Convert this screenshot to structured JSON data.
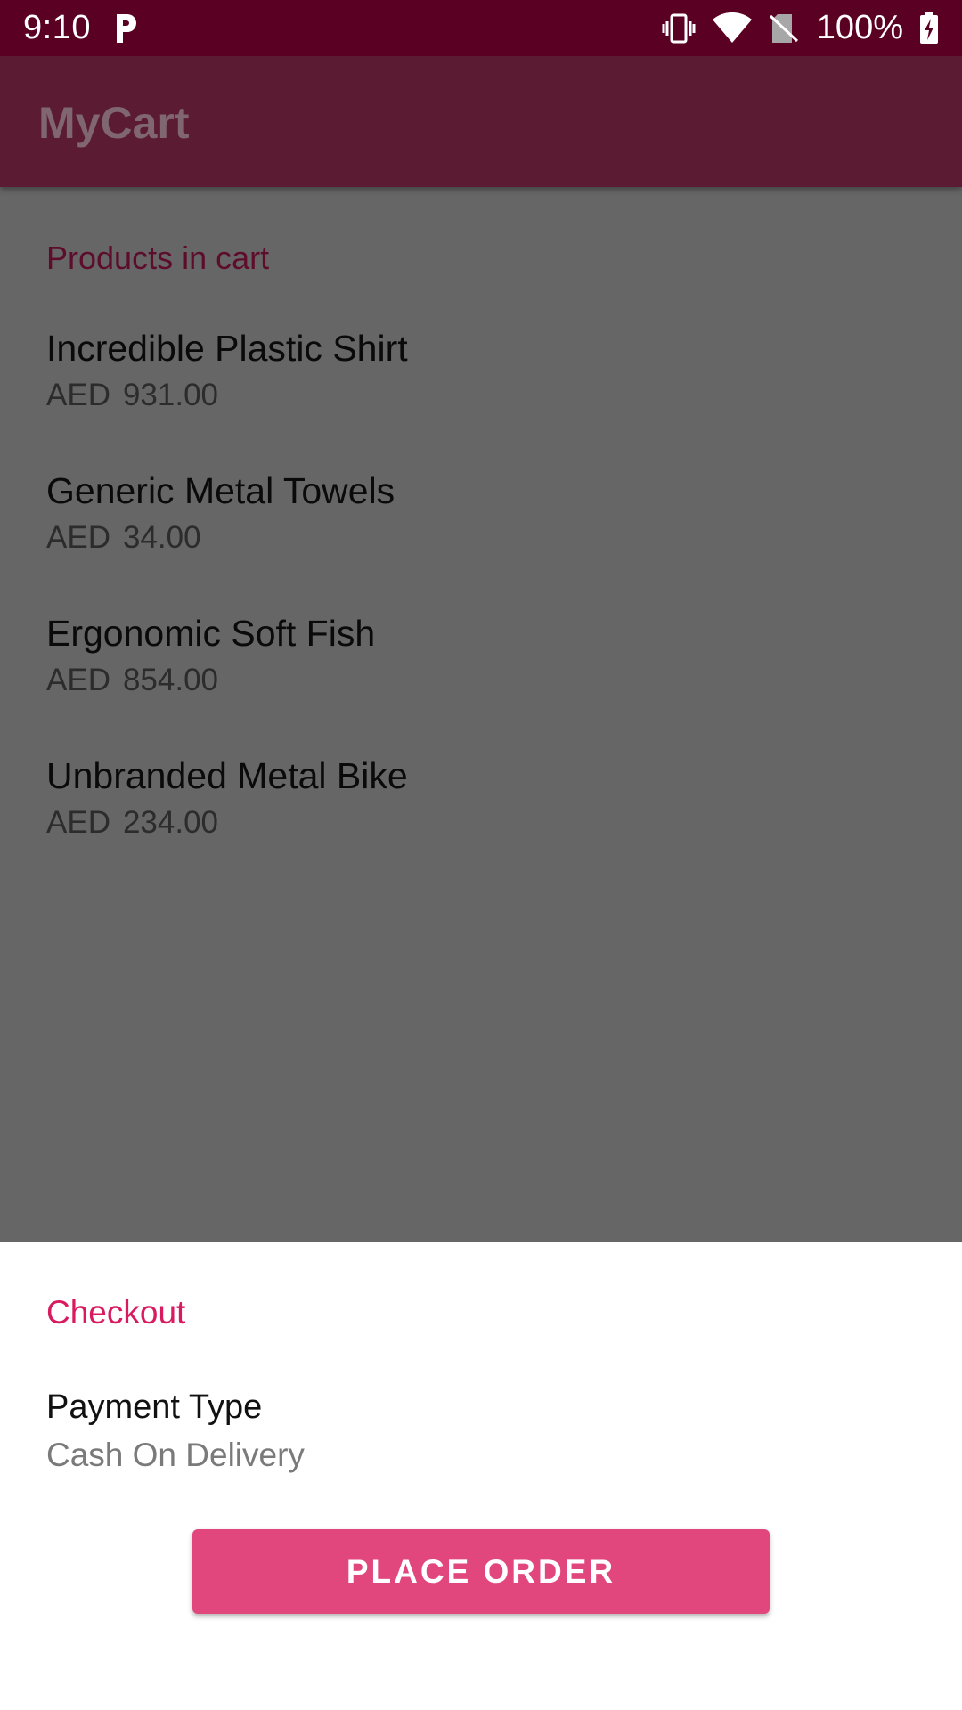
{
  "status_bar": {
    "time": "9:10",
    "notification_icon": "parking-p-icon",
    "battery_percent": "100%",
    "icons": [
      "vibrate-icon",
      "wifi-icon",
      "no-sim-icon",
      "battery-charging-icon"
    ]
  },
  "app_bar": {
    "title": "MyCart"
  },
  "cart": {
    "section_header": "Products in cart",
    "items": [
      {
        "name": "Incredible Plastic Shirt",
        "currency": "AED",
        "price": "931.00"
      },
      {
        "name": "Generic Metal Towels",
        "currency": "AED",
        "price": "34.00"
      },
      {
        "name": "Ergonomic Soft Fish",
        "currency": "AED",
        "price": "854.00"
      },
      {
        "name": "Unbranded Metal Bike",
        "currency": "AED",
        "price": "234.00"
      }
    ]
  },
  "checkout": {
    "title": "Checkout",
    "payment_label": "Payment Type",
    "payment_value": "Cash On Delivery",
    "place_order_label": "PLACE ORDER"
  },
  "colors": {
    "status_bar": "#5a0023",
    "app_bar_dimmed": "#5b1b33",
    "accent": "#d81b60",
    "button": "#e1477d",
    "scrim": "#666666"
  }
}
